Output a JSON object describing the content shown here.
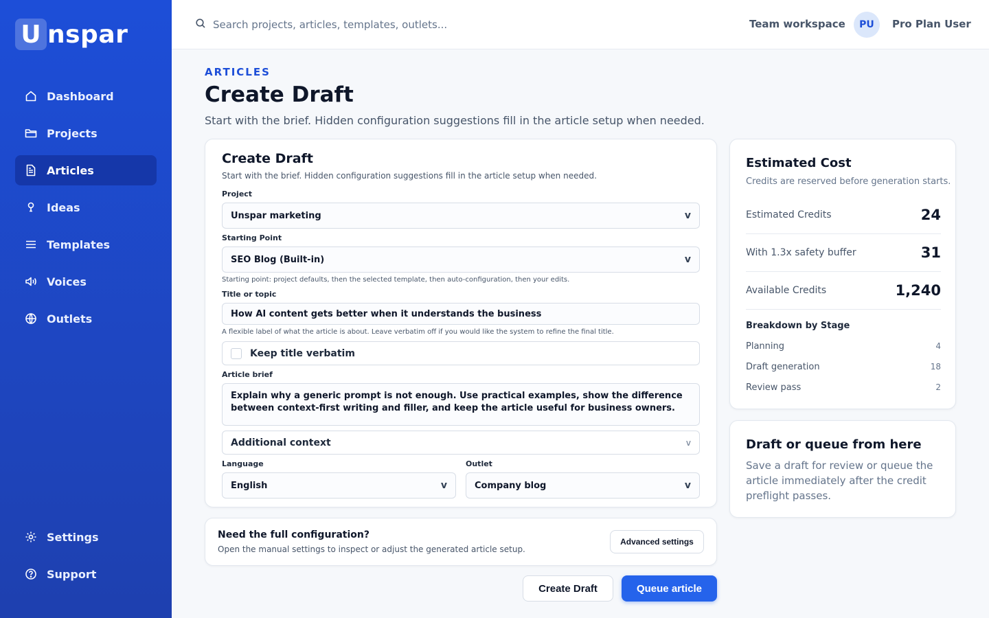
{
  "brand": {
    "logo_letter": "U",
    "logo_rest": "nspar"
  },
  "sidebar": {
    "items": [
      {
        "label": "Dashboard",
        "icon": "home-icon",
        "active": false
      },
      {
        "label": "Projects",
        "icon": "folder-icon",
        "active": false
      },
      {
        "label": "Articles",
        "icon": "document-icon",
        "active": true
      },
      {
        "label": "Ideas",
        "icon": "lightbulb-icon",
        "active": false
      },
      {
        "label": "Templates",
        "icon": "list-icon",
        "active": false
      },
      {
        "label": "Voices",
        "icon": "speaker-icon",
        "active": false
      },
      {
        "label": "Outlets",
        "icon": "globe-icon",
        "active": false
      }
    ],
    "bottom": [
      {
        "label": "Settings",
        "icon": "gear-icon"
      },
      {
        "label": "Support",
        "icon": "help-icon"
      }
    ]
  },
  "topbar": {
    "search_placeholder": "Search projects, articles, templates, outlets...",
    "workspace": "Team workspace",
    "avatar_initials": "PU",
    "user_name": "Pro Plan User"
  },
  "header": {
    "eyebrow": "ARTICLES",
    "title": "Create Draft",
    "subtitle": "Start with the brief. Hidden configuration suggestions fill in the article setup when needed."
  },
  "form": {
    "title": "Create Draft",
    "subtitle": "Start with the brief. Hidden configuration suggestions fill in the article setup when needed.",
    "project_label": "Project",
    "project_value": "Unspar marketing",
    "starting_label": "Starting Point",
    "starting_value": "SEO Blog (Built-in)",
    "starting_help": "Starting point: project defaults, then the selected template, then auto-configuration, then your edits.",
    "title_label": "Title or topic",
    "title_value": "How AI content gets better when it understands the business",
    "title_help": "A flexible label of what the article is about. Leave verbatim off if you would like the system to refine the final title.",
    "verbatim_label": "Keep title verbatim",
    "brief_label": "Article brief",
    "brief_value": "Explain why a generic prompt is not enough. Use practical examples, show the difference between context-first writing and filler, and keep the article useful for business owners.",
    "additional_label": "Additional context",
    "language_label": "Language",
    "language_value": "English",
    "outlet_label": "Outlet",
    "outlet_value": "Company blog",
    "chevron": "v"
  },
  "config": {
    "title": "Need the full configuration?",
    "subtitle": "Open the manual settings to inspect or adjust the generated article setup.",
    "button": "Advanced settings"
  },
  "actions": {
    "draft": "Create Draft",
    "queue": "Queue article"
  },
  "cost": {
    "title": "Estimated Cost",
    "subtitle": "Credits are reserved before generation starts.",
    "rows": [
      {
        "label": "Estimated Credits",
        "value": "24"
      },
      {
        "label": "With 1.3x safety buffer",
        "value": "31"
      },
      {
        "label": "Available Credits",
        "value": "1,240"
      }
    ],
    "breakdown_title": "Breakdown by Stage",
    "breakdown": [
      {
        "label": "Planning",
        "value": "4"
      },
      {
        "label": "Draft generation",
        "value": "18"
      },
      {
        "label": "Review pass",
        "value": "2"
      }
    ]
  },
  "queue_card": {
    "title": "Draft or queue from here",
    "body": "Save a draft for review or queue the article immediately after the credit preflight passes."
  },
  "colors": {
    "sidebar": "#1d4ed8",
    "accent": "#2563eb",
    "eyebrow": "#1d4ed8"
  }
}
